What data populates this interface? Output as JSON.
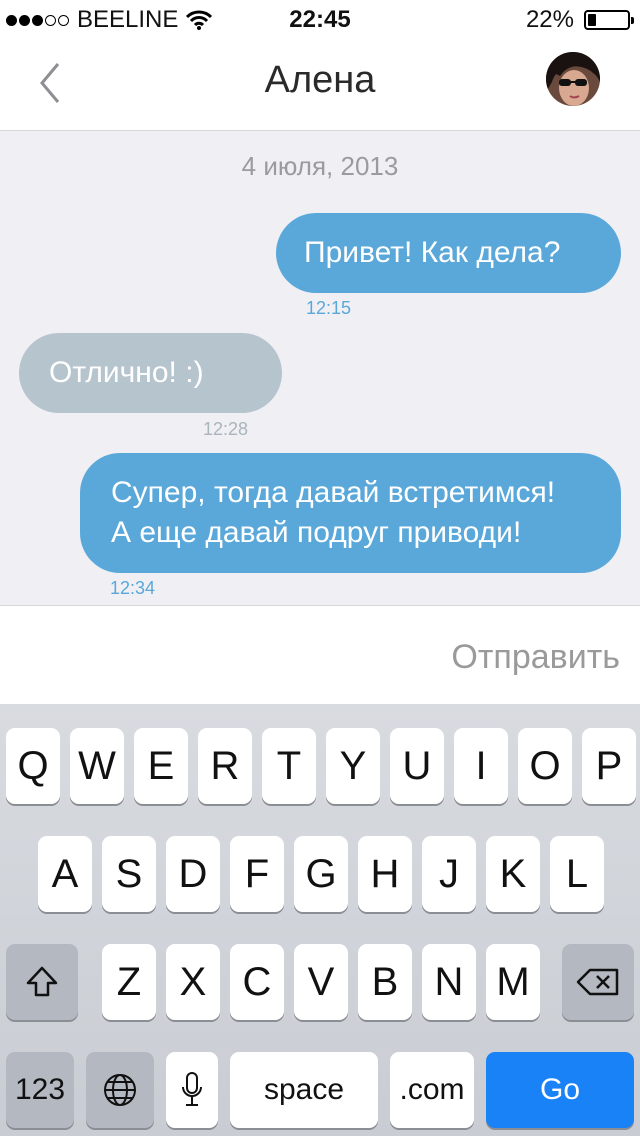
{
  "status_bar": {
    "carrier": "BEELINE",
    "time": "22:45",
    "battery_percent": "22%",
    "battery_level": 0.22,
    "signal_bars_filled": 3,
    "signal_bars_total": 5
  },
  "nav": {
    "title": "Алена",
    "back_icon": "chevron-left-icon",
    "avatar": "contact-avatar"
  },
  "chat": {
    "date": "4 июля, 2013",
    "messages": [
      {
        "direction": "outgoing",
        "text_lines": [
          "Привет! Как дела?"
        ],
        "time": "12:15"
      },
      {
        "direction": "incoming",
        "text_lines": [
          "Отлично! :)"
        ],
        "time": "12:28"
      },
      {
        "direction": "outgoing",
        "text_lines": [
          "Супер, тогда давай встретимся!",
          "А еще давай подруг приводи!"
        ],
        "time": "12:34"
      }
    ]
  },
  "composer": {
    "value": "",
    "send_label": "Отправить"
  },
  "keyboard": {
    "row1": [
      "Q",
      "W",
      "E",
      "R",
      "T",
      "Y",
      "U",
      "I",
      "O",
      "P"
    ],
    "row2": [
      "A",
      "S",
      "D",
      "F",
      "G",
      "H",
      "J",
      "K",
      "L"
    ],
    "row3": [
      "Z",
      "X",
      "C",
      "V",
      "B",
      "N",
      "M"
    ],
    "numbers_label": "123",
    "space_label": "space",
    "dotcom_label": ".com",
    "go_label": "Go",
    "icons": {
      "shift": "shift-icon",
      "backspace": "backspace-icon",
      "globe": "globe-icon",
      "mic": "microphone-icon"
    }
  },
  "colors": {
    "outgoing_bubble": "#5aa8da",
    "incoming_bubble": "#b6c4ce",
    "chat_bg": "#efeff4",
    "go_key": "#1a82f7"
  }
}
